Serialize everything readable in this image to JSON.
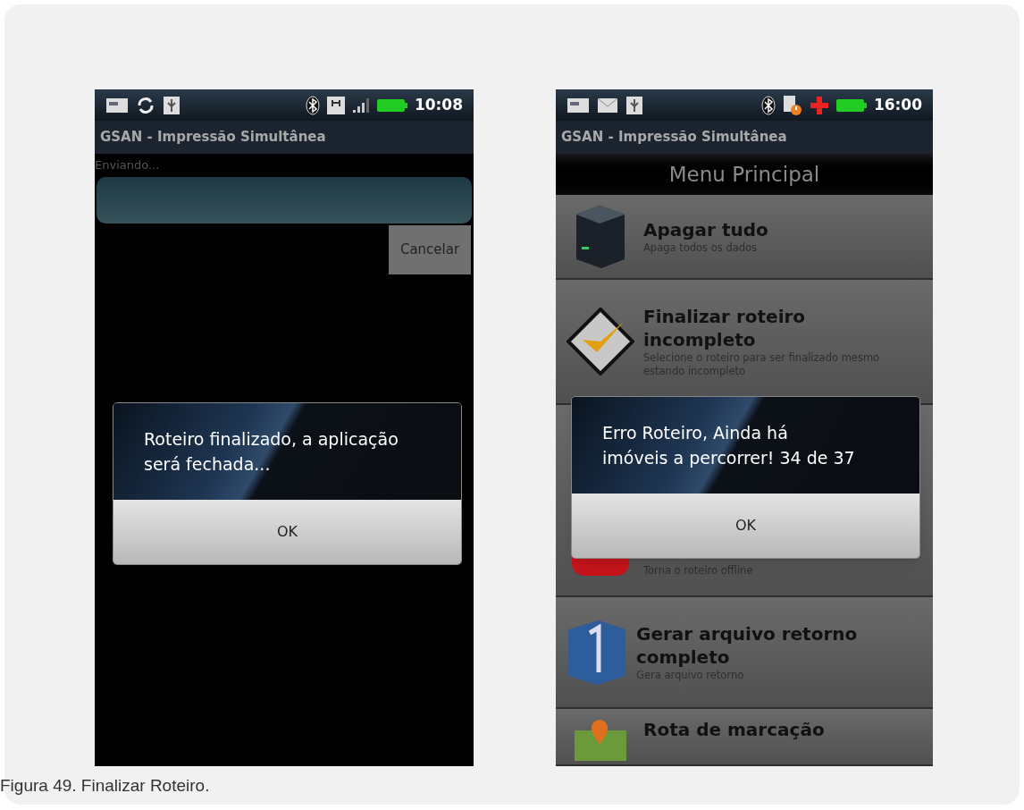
{
  "screens": [
    {
      "kind": "progress",
      "status_time": "10:08",
      "app_title": "GSAN - Impressão Simultânea",
      "progress_label": "Enviando...",
      "progress": {
        "level": 1
      },
      "cancel_button": "Cancelar",
      "dialog": {
        "message": "Roteiro finalizado, a aplicação será fechada...",
        "button": "OK"
      }
    },
    {
      "kind": "menu",
      "status_time": "16:00",
      "app_title": "GSAN - Impressão Simultânea",
      "menu_title": "Menu Principal",
      "items": [
        {
          "title": "Apagar tudo",
          "subtitle": "Apaga todos os dados"
        },
        {
          "title": "Finalizar roteiro incompleto",
          "subtitle": "Selecione o roteiro para ser finalizado mesmo estando incompleto"
        },
        {
          "subtitle": "Torna o roteiro offline"
        },
        {
          "title": "Gerar arquivo retorno completo",
          "subtitle": "Gera arquivo retorno"
        },
        {
          "title": "Rota de marcação"
        }
      ],
      "dialog": {
        "message": "Erro Roteiro, Ainda há imóveis a percorrer! 34 de 37",
        "button": "OK"
      }
    }
  ],
  "caption": "Figura 49. Finalizar Roteiro."
}
